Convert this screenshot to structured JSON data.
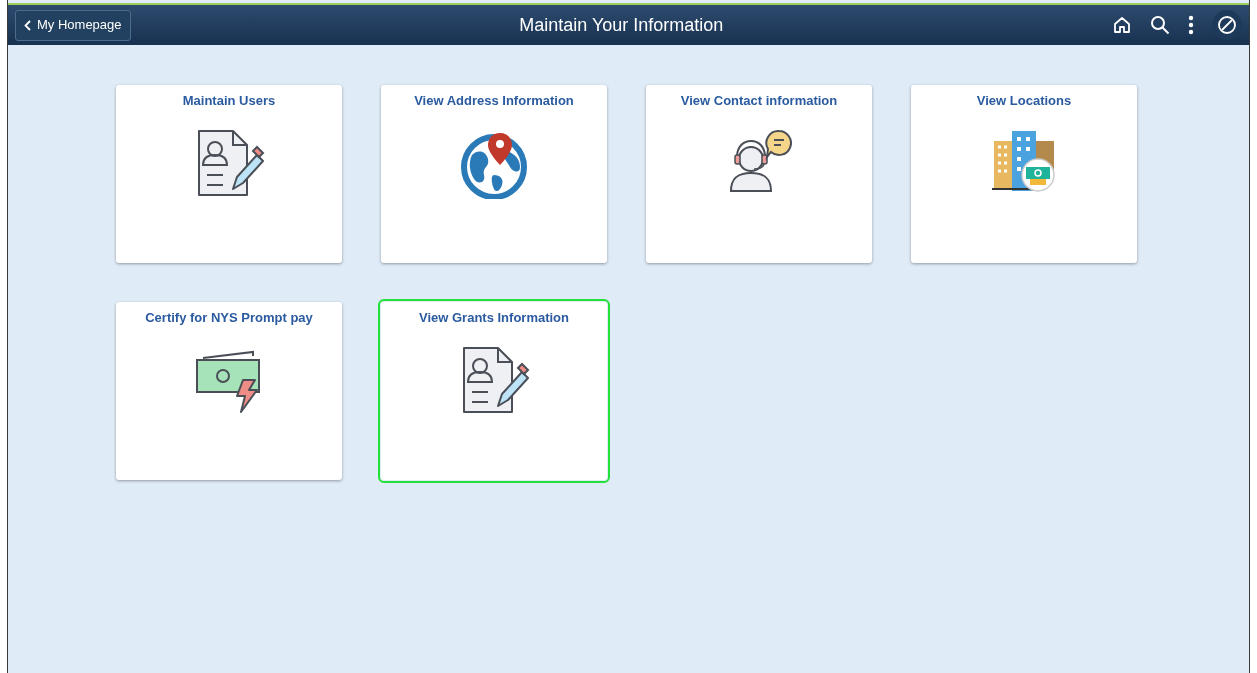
{
  "header": {
    "back_button": "My Homepage",
    "title": "Maintain Your Information"
  },
  "tiles": [
    {
      "title": "Maintain Users",
      "kind": "document",
      "selected": false
    },
    {
      "title": "View Address Information",
      "kind": "globe",
      "selected": false
    },
    {
      "title": "View Contact information",
      "kind": "support",
      "selected": false
    },
    {
      "title": "View Locations",
      "kind": "buildings",
      "selected": false
    },
    {
      "title": "Certify for NYS Prompt pay",
      "kind": "money",
      "selected": false
    },
    {
      "title": "View Grants Information",
      "kind": "document",
      "selected": true
    }
  ]
}
